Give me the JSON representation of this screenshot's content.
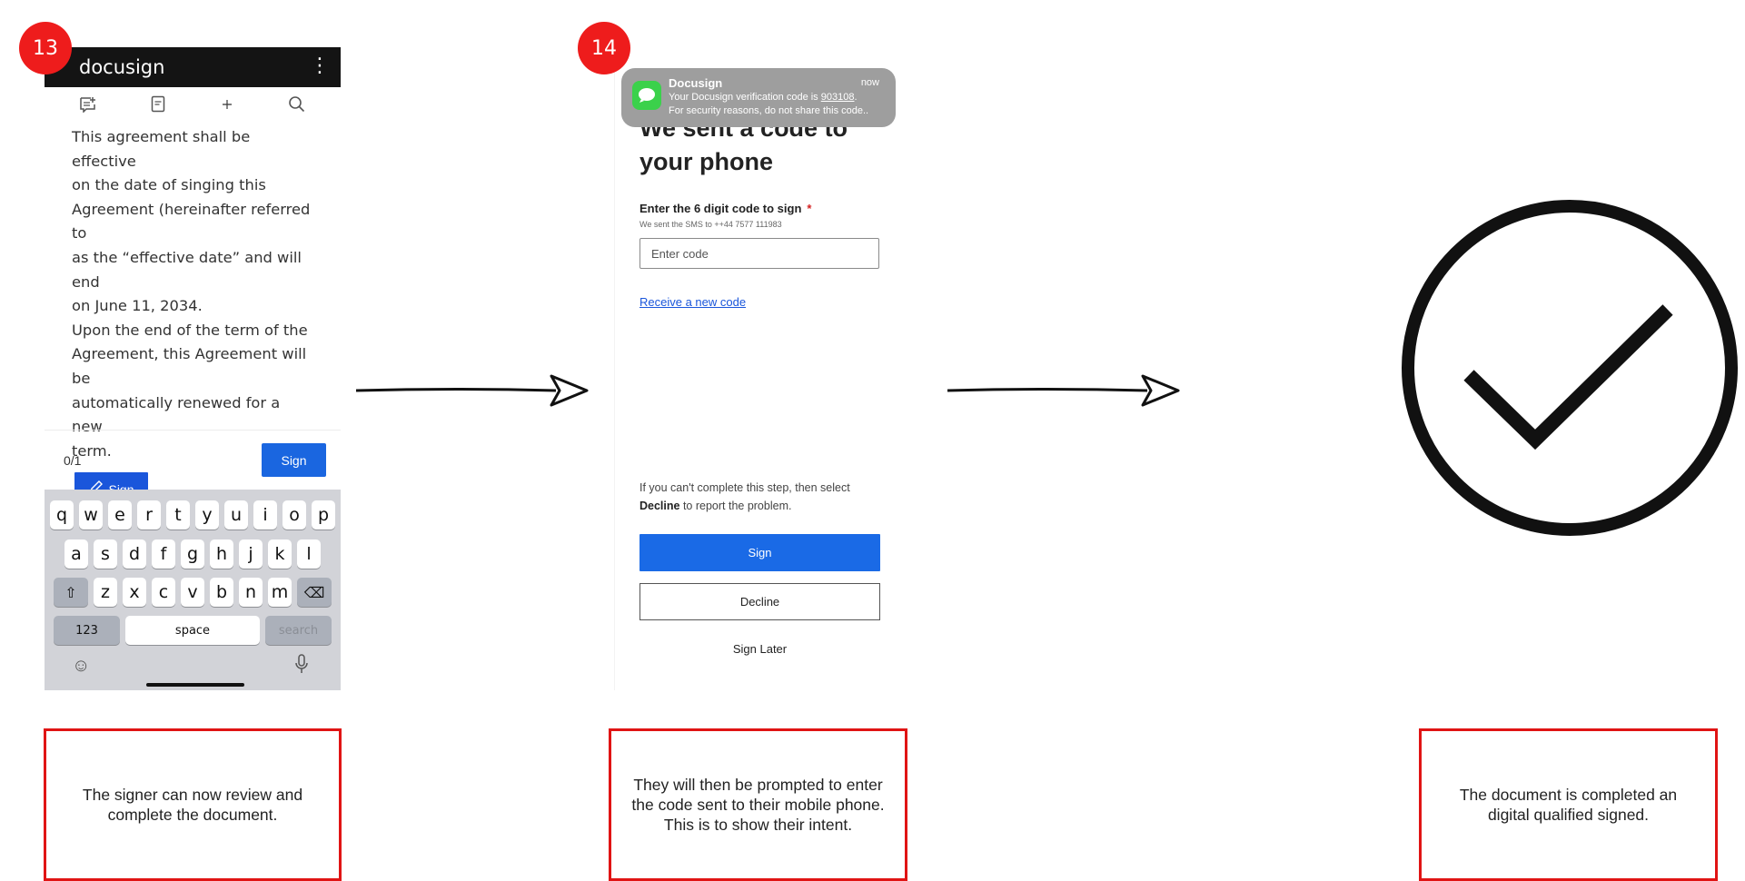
{
  "steps": {
    "step1": "13",
    "step2": "14"
  },
  "phone1": {
    "app_name": "docusign",
    "menu_glyph": "⋮",
    "toolbar_icons": [
      "comment-add-icon",
      "document-icon",
      "sparkle-icon",
      "search-icon"
    ],
    "body_lines": [
      "This agreement shall be effective",
      "on the date of singing this",
      "Agreement (hereinafter referred to",
      "as the “effective date” and will end",
      "on June 11, 2034.",
      "Upon the end of the term of the",
      "Agreement, this Agreement will be",
      "automatically renewed for a new",
      "term."
    ],
    "sign_field_label": "Sign",
    "progress": "0/1",
    "footer_sign": "Sign",
    "keyboard": {
      "row1": [
        "q",
        "w",
        "e",
        "r",
        "t",
        "y",
        "u",
        "i",
        "o",
        "p"
      ],
      "row2": [
        "a",
        "s",
        "d",
        "f",
        "g",
        "h",
        "j",
        "k",
        "l"
      ],
      "row3": [
        "z",
        "x",
        "c",
        "v",
        "b",
        "n",
        "m"
      ],
      "numbers_key": "123",
      "space_key": "space",
      "search_key": "search"
    }
  },
  "notification": {
    "app": "Docusign",
    "time": "now",
    "line1_prefix": "Your Docusign verification code is ",
    "code": "903108",
    "line1_suffix": ".",
    "line2": "For security reasons, do not share this code.."
  },
  "phone2": {
    "heading_line1": "We sent a code to",
    "heading_line2": "your phone",
    "field_label": "Enter the 6 digit code to sign",
    "required_mark": "*",
    "sms_note": "We sent the SMS to ++44 7577 111983",
    "input_placeholder": "Enter code",
    "resend_link": "Receive a new code",
    "help_line1": "If you can't complete this step,  then select",
    "help_bold": "Decline",
    "help_line2_rest": " to report the problem.",
    "sign_button": "Sign",
    "decline_button": "Decline",
    "later_button": "Sign Later"
  },
  "captions": {
    "left": "The signer can now review and complete the document.",
    "middle": "They will then be prompted to enter the code sent to their mobile phone. This is to show their intent.",
    "right": "The document is completed an digital qualified signed."
  },
  "colors": {
    "badge": "#ee1c1c",
    "caption_border": "#e01414",
    "primary": "#1a66e0",
    "notification_green": "#3bd14b"
  }
}
